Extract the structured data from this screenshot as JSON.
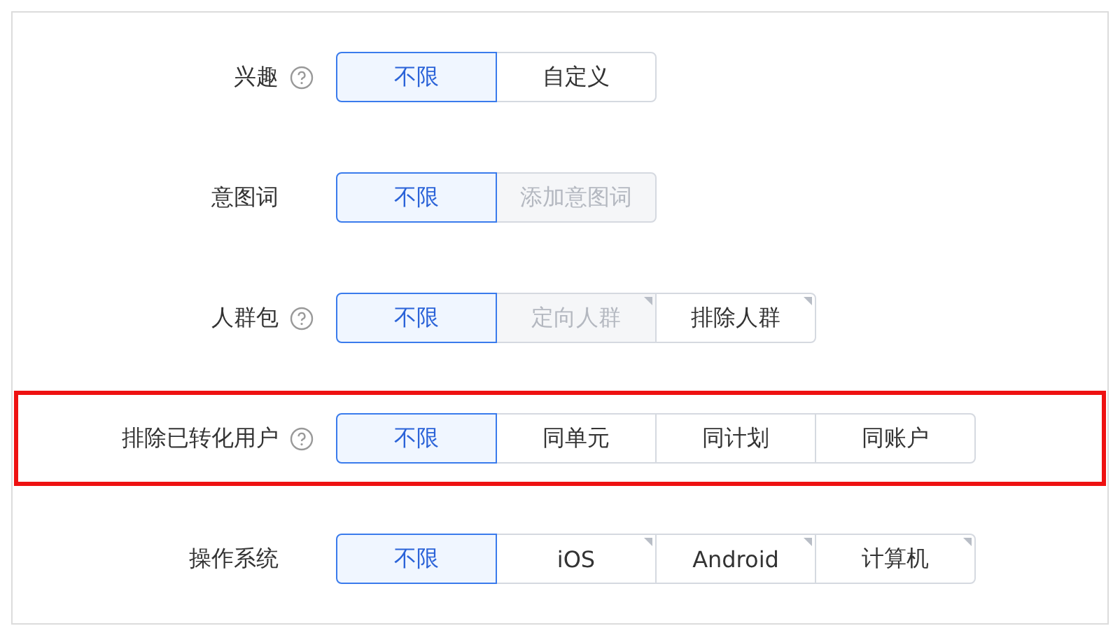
{
  "rows": [
    {
      "label": "兴趣",
      "help": true,
      "highlighted": false,
      "options": [
        {
          "label": "不限",
          "selected": true,
          "disabled": false,
          "corner_mark": false
        },
        {
          "label": "自定义",
          "selected": false,
          "disabled": false,
          "corner_mark": false
        }
      ]
    },
    {
      "label": "意图词",
      "help": false,
      "highlighted": false,
      "options": [
        {
          "label": "不限",
          "selected": true,
          "disabled": false,
          "corner_mark": false
        },
        {
          "label": "添加意图词",
          "selected": false,
          "disabled": true,
          "corner_mark": false
        }
      ]
    },
    {
      "label": "人群包",
      "help": true,
      "highlighted": false,
      "options": [
        {
          "label": "不限",
          "selected": true,
          "disabled": false,
          "corner_mark": false
        },
        {
          "label": "定向人群",
          "selected": false,
          "disabled": true,
          "corner_mark": true
        },
        {
          "label": "排除人群",
          "selected": false,
          "disabled": false,
          "corner_mark": true
        }
      ]
    },
    {
      "label": "排除已转化用户",
      "help": true,
      "highlighted": true,
      "options": [
        {
          "label": "不限",
          "selected": true,
          "disabled": false,
          "corner_mark": false
        },
        {
          "label": "同单元",
          "selected": false,
          "disabled": false,
          "corner_mark": false
        },
        {
          "label": "同计划",
          "selected": false,
          "disabled": false,
          "corner_mark": false
        },
        {
          "label": "同账户",
          "selected": false,
          "disabled": false,
          "corner_mark": false
        }
      ]
    },
    {
      "label": "操作系统",
      "help": false,
      "highlighted": false,
      "options": [
        {
          "label": "不限",
          "selected": true,
          "disabled": false,
          "corner_mark": false
        },
        {
          "label": "iOS",
          "selected": false,
          "disabled": false,
          "corner_mark": true
        },
        {
          "label": "Android",
          "selected": false,
          "disabled": false,
          "corner_mark": true
        },
        {
          "label": "计算机",
          "selected": false,
          "disabled": false,
          "corner_mark": true
        }
      ]
    }
  ]
}
